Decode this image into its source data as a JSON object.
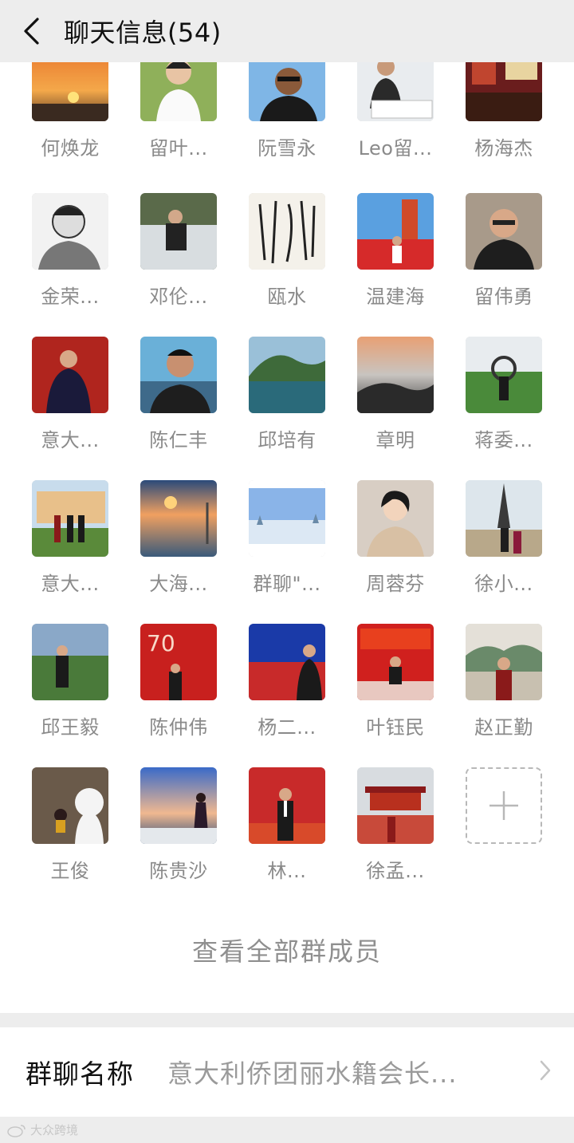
{
  "header": {
    "title": "聊天信息(54)"
  },
  "icons": {
    "back": "chevron-left-icon",
    "add": "plus-icon",
    "chevron": "chevron-right-icon",
    "watermark": "weibo-icon"
  },
  "members": [
    {
      "name": "何焕龙"
    },
    {
      "name": "留叶..."
    },
    {
      "name": "阮雪永"
    },
    {
      "name": "Leo留..."
    },
    {
      "name": "杨海杰"
    },
    {
      "name": "金荣..."
    },
    {
      "name": "邓伦..."
    },
    {
      "name": "瓯水"
    },
    {
      "name": "温建海"
    },
    {
      "name": "留伟勇"
    },
    {
      "name": "意大..."
    },
    {
      "name": "陈仁丰"
    },
    {
      "name": "邱培有"
    },
    {
      "name": "章明"
    },
    {
      "name": "蒋委..."
    },
    {
      "name": "意大..."
    },
    {
      "name": "大海..."
    },
    {
      "name": "群聊\"..."
    },
    {
      "name": "周蓉芬"
    },
    {
      "name": "徐小..."
    },
    {
      "name": "邱王毅"
    },
    {
      "name": "陈仲伟"
    },
    {
      "name": "杨二..."
    },
    {
      "name": "叶钰民"
    },
    {
      "name": "赵正勤"
    },
    {
      "name": "王俊"
    },
    {
      "name": "陈贵沙"
    },
    {
      "name": "林..."
    },
    {
      "name": "徐孟..."
    }
  ],
  "view_all": {
    "label": "查看全部群成员"
  },
  "group_name": {
    "label": "群聊名称",
    "value": "意大利侨团丽水籍会长..."
  },
  "watermark": {
    "text": "大众跨境"
  }
}
